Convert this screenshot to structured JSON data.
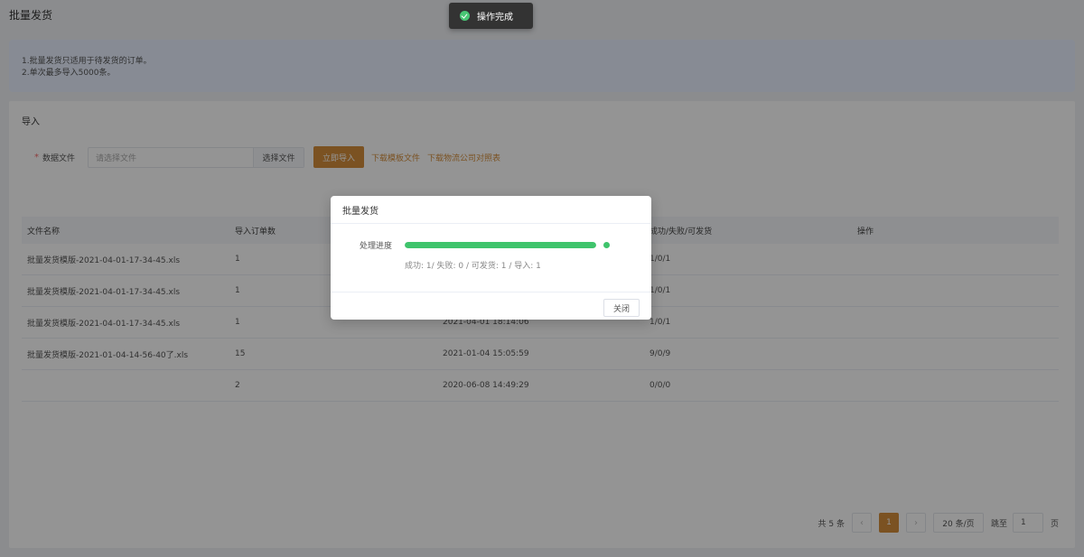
{
  "page": {
    "title": "批量发货"
  },
  "notice": {
    "lines": [
      "1.批量发货只适用于待发货的订单。",
      "2.单次最多导入5000条。"
    ]
  },
  "import": {
    "section_title": "导入",
    "required_mark": "*",
    "field_label": "数据文件",
    "file_placeholder": "请选择文件",
    "choose_label": "选择文件",
    "import_button": "立即导入",
    "template_link": "下载模板文件",
    "logistics_link": "下载物流公司对照表"
  },
  "table": {
    "headers": [
      "文件名称",
      "导入订单数",
      "",
      "成功/失败/可发货",
      "操作"
    ],
    "rows": [
      {
        "name": "批量发货模版-2021-04-01-17-34-45.xls",
        "count": "1",
        "time": "",
        "result": "1/0/1"
      },
      {
        "name": "批量发货模版-2021-04-01-17-34-45.xls",
        "count": "1",
        "time": "",
        "result": "1/0/1"
      },
      {
        "name": "批量发货模版-2021-04-01-17-34-45.xls",
        "count": "1",
        "time": "2021-04-01 18:14:06",
        "result": "1/0/1"
      },
      {
        "name": "批量发货模版-2021-01-04-14-56-40了.xls",
        "count": "15",
        "time": "2021-01-04 15:05:59",
        "result": "9/0/9"
      },
      {
        "name": "",
        "count": "2",
        "time": "2020-06-08 14:49:29",
        "result": "0/0/0"
      }
    ]
  },
  "pagination": {
    "total": "共 5 条",
    "prev_icon": "‹",
    "current_page": "1",
    "next_icon": "›",
    "page_size": "20 条/页",
    "jump_label": "跳至",
    "jump_value": "1",
    "page_unit": "页"
  },
  "toast": {
    "message": "操作完成",
    "icon": "check-circle-icon",
    "color": "#48c774"
  },
  "modal": {
    "title": "批量发货",
    "progress_label": "处理进度",
    "progress_fraction": 1.0,
    "stats": "成功: 1/ 失败: 0 / 可发货: 1 / 导入: 1",
    "close_button": "关闭"
  },
  "colors": {
    "accent": "#d48e3c",
    "success": "#3fc46c"
  }
}
